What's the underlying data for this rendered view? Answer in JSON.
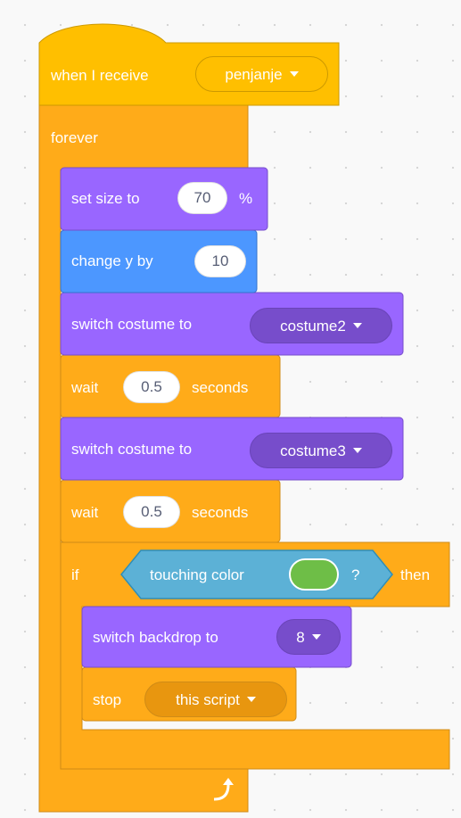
{
  "colors": {
    "events": "#FFBF00",
    "control": "#FFAB19",
    "looks": "#9966FF",
    "motion": "#4C97FF",
    "sensing": "#5CB1D6",
    "swatch": "#6EBE47"
  },
  "script": {
    "hat": {
      "label": "when I receive",
      "message": "penjanje"
    },
    "forever": {
      "label": "forever",
      "loop_icon": "loop-arrow-icon"
    },
    "set_size": {
      "label": "set size to",
      "value": "70",
      "suffix": "%"
    },
    "change_y": {
      "label": "change y by",
      "value": "10"
    },
    "switch_costume_1": {
      "label": "switch costume to",
      "costume": "costume2"
    },
    "wait_1": {
      "label": "wait",
      "value": "0.5",
      "suffix": "seconds"
    },
    "switch_costume_2": {
      "label": "switch costume to",
      "costume": "costume3"
    },
    "wait_2": {
      "label": "wait",
      "value": "0.5",
      "suffix": "seconds"
    },
    "if_block": {
      "label": "if",
      "then": "then",
      "condition": {
        "label": "touching color",
        "suffix": "?"
      }
    },
    "switch_backdrop": {
      "label": "switch backdrop to",
      "backdrop": "8"
    },
    "stop": {
      "label": "stop",
      "option": "this script"
    }
  }
}
